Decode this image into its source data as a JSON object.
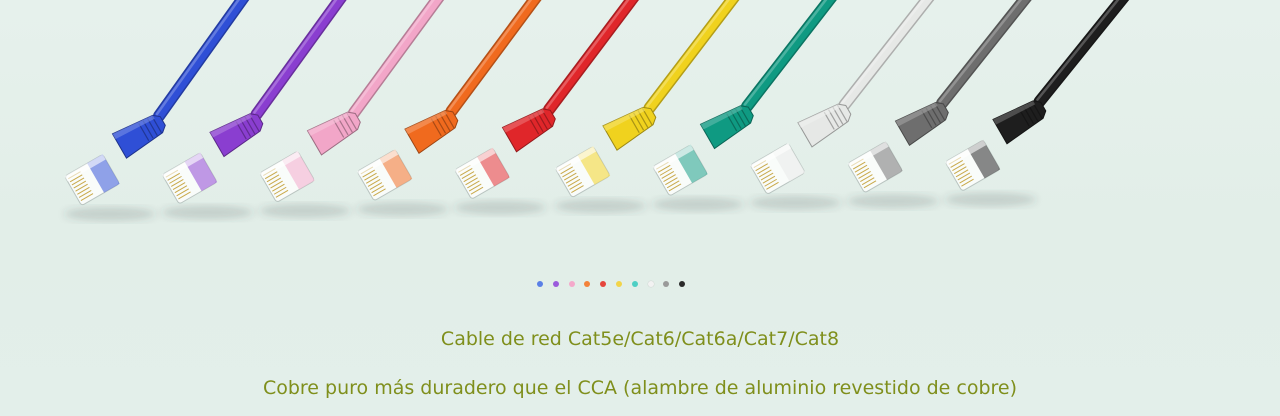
{
  "banner": {
    "cables": [
      {
        "name": "blue",
        "color": "#2f4fd6"
      },
      {
        "name": "purple",
        "color": "#8a3ed0"
      },
      {
        "name": "pink",
        "color": "#f2a6c8"
      },
      {
        "name": "orange",
        "color": "#f06a1e"
      },
      {
        "name": "red",
        "color": "#e0262a"
      },
      {
        "name": "yellow",
        "color": "#f0d21e"
      },
      {
        "name": "teal",
        "color": "#0f9a82"
      },
      {
        "name": "white",
        "color": "#e6e8e6"
      },
      {
        "name": "gray",
        "color": "#6e6e6e"
      },
      {
        "name": "black",
        "color": "#1e1e1e"
      }
    ],
    "dot_colors": [
      "#5a7fe6",
      "#9b5bdc",
      "#f4a9cb",
      "#f3823a",
      "#e5453c",
      "#f2d449",
      "#4ecfc4",
      "#f2f2f2",
      "#9a9a9a",
      "#2a2a2a"
    ],
    "title": "Cable de red Cat5e/Cat6/Cat6a/Cat7/Cat8",
    "subtitle": "Cobre puro más duradero que el CCA (alambre de aluminio revestido de cobre)"
  }
}
